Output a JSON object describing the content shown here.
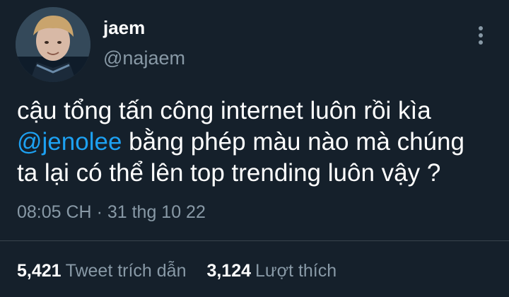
{
  "author": {
    "display_name": "jaem",
    "handle": "@najaem",
    "avatar_icon": "profile-photo"
  },
  "tweet": {
    "line1": "cậu tổng tấn công internet luôn rồi kìa",
    "mention": "@jenolee",
    "line2_rest": " bằng phép màu nào mà chúng",
    "line3": "ta lại có thể lên top trending luôn vậy ?"
  },
  "meta": {
    "time": "08:05 CH",
    "separator": " · ",
    "date": "31 thg 10 22"
  },
  "stats": {
    "quotes_value": "5,421",
    "quotes_label": "Tweet trích dẫn",
    "likes_value": "3,124",
    "likes_label": "Lượt thích"
  },
  "colors": {
    "background": "#15202b",
    "text": "#ffffff",
    "secondary": "#8899a6",
    "link": "#1da1f2",
    "divider": "#38444d"
  },
  "icons": {
    "more": "more-vertical-icon"
  }
}
